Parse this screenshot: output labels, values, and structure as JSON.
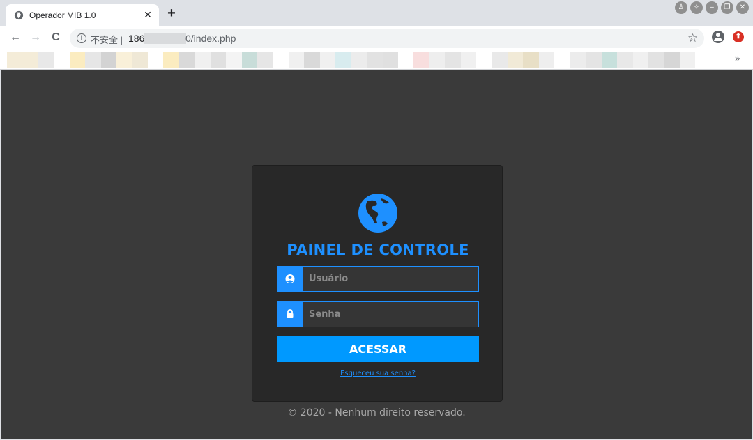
{
  "browser": {
    "tab": {
      "title": "Operador MIB 1.0",
      "close_glyph": "✕",
      "favicon": "globe-icon"
    },
    "new_tab_glyph": "+",
    "window_controls": [
      "shirt-icon",
      "pin-icon",
      "minimize-icon",
      "restore-icon",
      "close-icon"
    ],
    "nav": {
      "back": "←",
      "forward": "→",
      "reload": "C"
    },
    "address": {
      "security_label": "不安全",
      "separator": "|",
      "url_prefix": "186",
      "url_suffix": "0/index.php"
    },
    "bookmarks_overflow": "»",
    "bookmark_colors": [
      "#f4ecd8",
      "#f4ecd8",
      "#e8e8e8",
      "#ffffff",
      "#fbecc0",
      "#e6e6e6",
      "#d3d3d3",
      "#f9f0d9",
      "#efe8d6",
      "#ffffff",
      "#fbecc0",
      "#d9d9d9",
      "#f0f0f0",
      "#e0e0e0",
      "#f4f4f4",
      "#c8ddd9",
      "#e6e6e6",
      "#ffffff",
      "#f0f0f0",
      "#d9d9d9",
      "#f0f0f0",
      "#d8ecef",
      "#ececec",
      "#e2e2e2",
      "#e0e0e0",
      "#ffffff",
      "#f8dede",
      "#eeeeee",
      "#e4e4e4",
      "#f0f0f0",
      "#ffffff",
      "#e9e9e9",
      "#f1ead7",
      "#e8dfc6",
      "#eeeeee",
      "#ffffff",
      "#ececec",
      "#e4e4e4",
      "#c7e0dc",
      "#e8e8e8",
      "#f0f0f0",
      "#e2e2e2",
      "#d6d6d6",
      "#f0f0f0",
      "#ffffff",
      "#ffffff"
    ]
  },
  "page": {
    "title": "PAINEL DE CONTROLE",
    "username_placeholder": "Usuário",
    "password_placeholder": "Senha",
    "submit_label": "ACESSAR",
    "forgot_link": "Esqueceu sua senha?",
    "footer": "© 2020 - Nenhum direito reservado.",
    "accent_color": "#1e90ff",
    "button_color": "#0099ff"
  }
}
